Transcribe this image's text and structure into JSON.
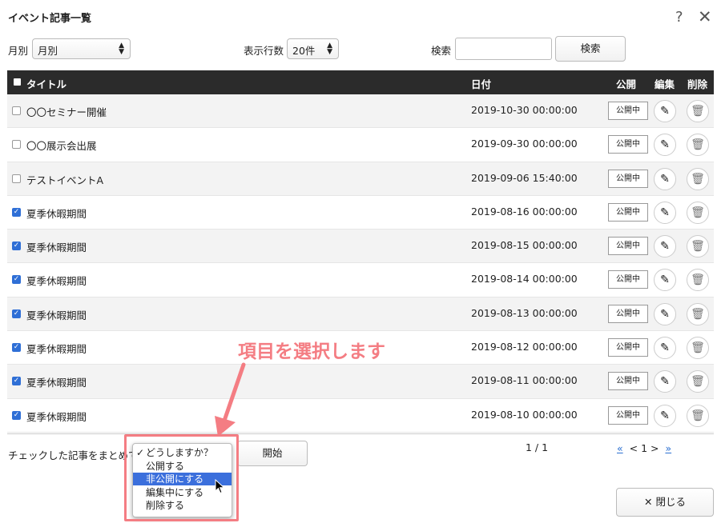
{
  "window": {
    "title": "イベント記事一覧",
    "help_glyph": "?",
    "close_glyph": "✕"
  },
  "filters": {
    "month_label": "月別",
    "month_value": "月別",
    "rows_label": "表示行数",
    "rows_value": "20件",
    "search_label": "検索",
    "search_value": "",
    "search_button": "検索"
  },
  "table": {
    "headers": {
      "title": "タイトル",
      "date": "日付",
      "publish": "公開",
      "edit": "編集",
      "delete": "削除"
    },
    "status_label": "公開中",
    "rows": [
      {
        "title": "〇〇セミナー開催",
        "date": "2019-10-30 00:00:00",
        "checked": false
      },
      {
        "title": "〇〇展示会出展",
        "date": "2019-09-30 00:00:00",
        "checked": false
      },
      {
        "title": "テストイベントA",
        "date": "2019-09-06 15:40:00",
        "checked": false
      },
      {
        "title": "夏季休暇期間",
        "date": "2019-08-16 00:00:00",
        "checked": true
      },
      {
        "title": "夏季休暇期間",
        "date": "2019-08-15 00:00:00",
        "checked": true
      },
      {
        "title": "夏季休暇期間",
        "date": "2019-08-14 00:00:00",
        "checked": true
      },
      {
        "title": "夏季休暇期間",
        "date": "2019-08-13 00:00:00",
        "checked": true
      },
      {
        "title": "夏季休暇期間",
        "date": "2019-08-12 00:00:00",
        "checked": true
      },
      {
        "title": "夏季休暇期間",
        "date": "2019-08-11 00:00:00",
        "checked": true
      },
      {
        "title": "夏季休暇期間",
        "date": "2019-08-10 00:00:00",
        "checked": true
      }
    ]
  },
  "bulk": {
    "label": "チェックした記事をまとめて",
    "start_button": "開始",
    "options": [
      "どうしますか？",
      "公開する",
      "非公開にする",
      "編集中にする",
      "削除する"
    ],
    "current_option_index": 0,
    "hovered_option_index": 2
  },
  "pagination": {
    "info": "1 / 1",
    "first": "«",
    "prev": "<",
    "current": "1",
    "next": ">",
    "last": "»"
  },
  "footer": {
    "close_button": "✕ 閉じる"
  },
  "annotation": {
    "text": "項目を選択します",
    "color": "#f47d83"
  },
  "colors": {
    "header_bg": "#2b2b2b",
    "accent": "#3b6fdc",
    "link": "#2a6fd1"
  }
}
